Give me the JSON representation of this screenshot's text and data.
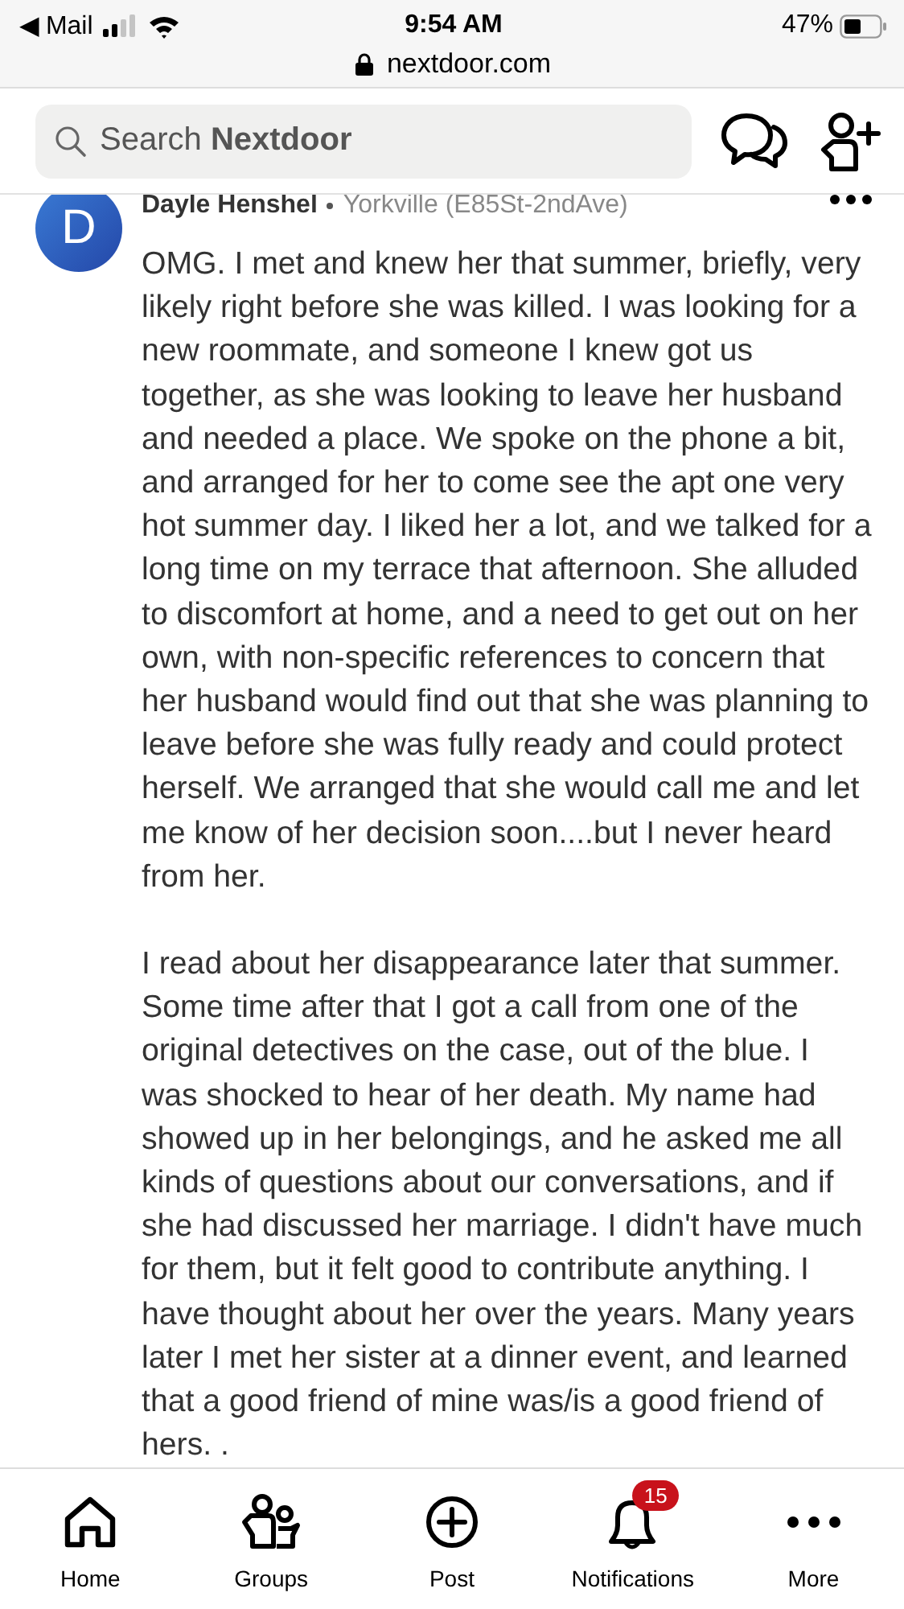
{
  "status_bar": {
    "back_app": "◀ Mail",
    "time": "9:54 AM",
    "battery": "47%",
    "url": "nextdoor.com"
  },
  "header": {
    "search": {
      "placeholder": "Search **Nextdoor**"
    }
  },
  "post": {
    "avatar_letter": "D",
    "author": "Dayle Henshel",
    "neighborhood": "Yorkville (E85St-2ndAve)",
    "paragraphs": [
      "OMG. I met and knew her that summer, briefly, very likely right before she was killed. I was looking for a new roommate, and someone I knew got us together, as she was looking to leave her husband and needed a place. We spoke on the phone a bit, and arranged for her to come see the apt one very hot summer day. I liked her a lot, and we talked for a long time on my terrace that afternoon. She alluded to discomfort at home, and a need to get out on her own, with non-specific references to concern that her husband would find out that she was planning to leave before she was fully ready and could protect herself. We arranged that she would call me and let me know of her decision soon....but I never heard from her.",
      "I read about her disappearance later that summer. Some time after that I got a call from one of the original detectives on the case, out of the blue. I was shocked to hear of her death. My name had showed up in her belongings, and he asked me all kinds of questions about our conversations, and if she had discussed her marriage. I didn't have much for them, but it felt good to contribute anything. I have thought about her over the years. Many years later I met her sister at a dinner event, and learned that a good friend of mine was/is a good friend of hers. ."
    ]
  },
  "nav": [
    {
      "kind": "home",
      "label": "Home"
    },
    {
      "kind": "groups",
      "label": "Groups"
    },
    {
      "kind": "post",
      "label": "Post"
    },
    {
      "kind": "notifications",
      "label": "Notifications",
      "badge": "15"
    },
    {
      "kind": "more",
      "label": "More"
    }
  ]
}
